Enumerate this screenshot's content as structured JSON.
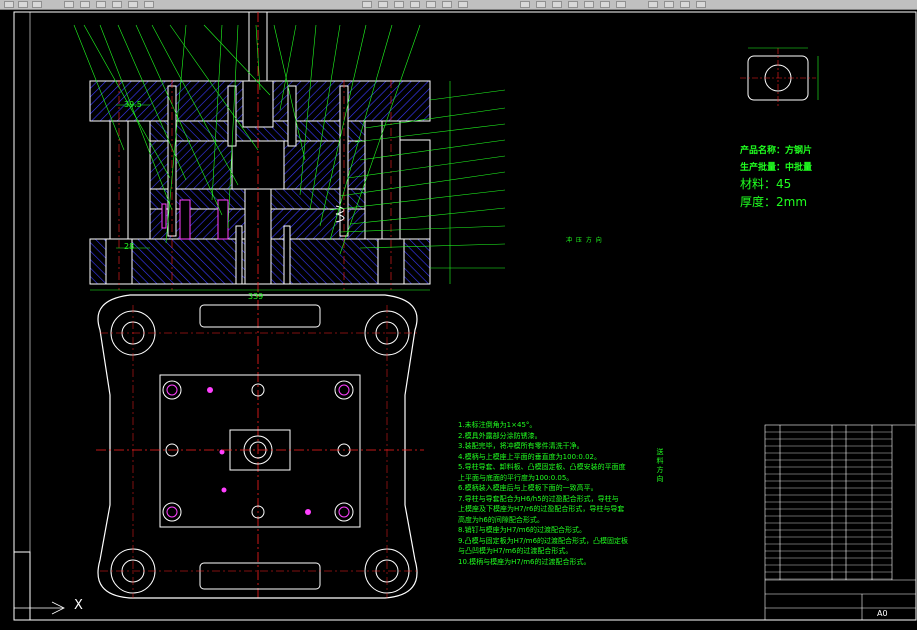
{
  "drawing": {
    "dimension_width": "339",
    "dimension_left_top": "39.5",
    "dimension_left_bottom": "28",
    "title_block_label": "A0"
  },
  "product": {
    "name": "产品名称：方钢片",
    "volume": "生产批量：中批量",
    "material": "材料：45",
    "thickness": "厚度：2mm"
  },
  "vertical_notes": {
    "direction": "送料方向",
    "middle": "冲 压 方 向"
  },
  "tech_requirements": [
    "1.未标注倒角为1×45°。",
    "2.模具外露部分涂防锈漆。",
    "3.装配完毕，将冲模所有零件清洗干净。",
    "4.模柄与上模座上平面的垂直度为100:0.02。",
    "5.导柱导套、卸料板、凸模固定板、凸模安装的平面度",
    "  上平面与底面的平行度为100:0.05。",
    "6.模柄装入模座后与上模板下面的一致高平。",
    "7.导柱与导套配合为H6/h5的过盈配合形式，导柱与",
    "  上模座及下模座为H7/r6的过盈配合形式，导柱与导套",
    "  高度为h6的间隙配合形式。",
    "8.销钉与模座为H7/m6的过渡配合形式。",
    "9.凸模与固定板为H7/m6的过渡配合形式，凸模固定板",
    "  与凸凹模为H7/m6的过渡配合形式。",
    "10.模柄与模座为H7/m6的过渡配合形式。"
  ],
  "bottom_left": {
    "axis_label": "X"
  }
}
